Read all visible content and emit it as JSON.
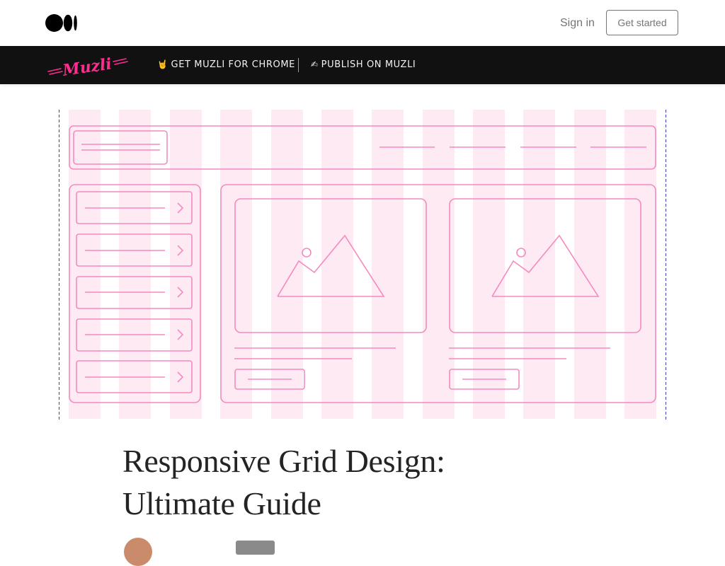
{
  "header": {
    "sign_in_label": "Sign in",
    "get_started_label": "Get started"
  },
  "muzli_bar": {
    "logo_text": "Muzli",
    "links": [
      {
        "emoji": "🤘",
        "label": "GET MUZLI FOR CHROME"
      },
      {
        "emoji": "✍",
        "label": "PUBLISH ON MUZLI"
      }
    ],
    "logo_color": "#ff2d8f"
  },
  "article": {
    "title_line1": "Responsive Grid Design:",
    "title_line2": "Ultimate Guide"
  },
  "colors": {
    "grid_stripe": "#fdeaf3",
    "wireframe_stroke": "#f58ac0",
    "guide_line": "#3d3db0"
  }
}
